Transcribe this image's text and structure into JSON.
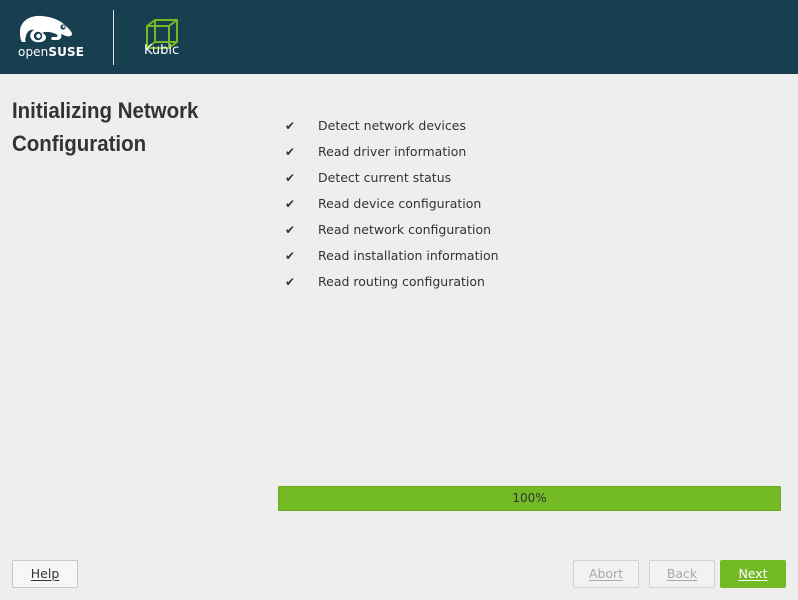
{
  "header": {
    "opensuse_logo": {
      "prefix": "open",
      "brand": "SUSE",
      "icon": "chameleon-icon"
    },
    "kubic_logo": {
      "label": "Kubic",
      "icon": "kubic-cube-icon"
    }
  },
  "page_title": "Initializing Network Configuration",
  "steps": [
    {
      "check": "✔",
      "label": "Detect network devices"
    },
    {
      "check": "✔",
      "label": "Read driver information"
    },
    {
      "check": "✔",
      "label": "Detect current status"
    },
    {
      "check": "✔",
      "label": "Read device configuration"
    },
    {
      "check": "✔",
      "label": "Read network configuration"
    },
    {
      "check": "✔",
      "label": "Read installation information"
    },
    {
      "check": "✔",
      "label": "Read routing configuration"
    }
  ],
  "progress": {
    "label": "100%",
    "fraction": 1.0
  },
  "buttons": {
    "help": "Help",
    "abort": "Abort",
    "back": "Back",
    "next": "Next"
  },
  "colors": {
    "header_bg": "#173f4f",
    "accent_green": "#73ba25",
    "page_bg": "#eeeeee"
  }
}
